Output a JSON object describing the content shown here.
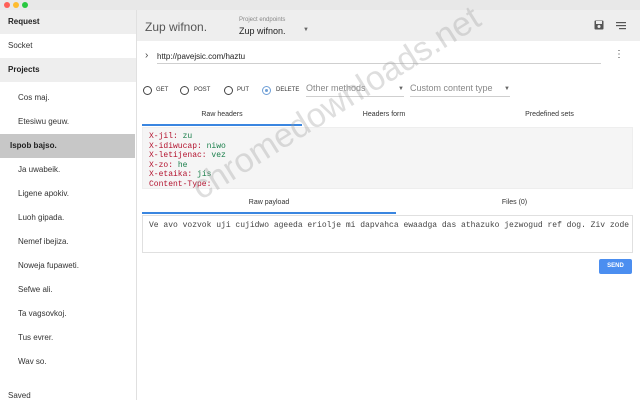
{
  "window": {
    "dots": [
      "#ff5f57",
      "#febc2e",
      "#28c840"
    ]
  },
  "sidebar": {
    "request_label": "Request",
    "socket_label": "Socket",
    "projects_label": "Projects",
    "projects": [
      {
        "label": "Cos maj."
      },
      {
        "label": "Etesiwu geuw."
      },
      {
        "label": "Ispob bajso."
      },
      {
        "label": "Ja uwabeik."
      },
      {
        "label": "Ligene apokiv."
      },
      {
        "label": "Luoh gipada."
      },
      {
        "label": "Nemef ibejiza."
      },
      {
        "label": "Noweja fupaweti."
      },
      {
        "label": "Sefwe ali."
      },
      {
        "label": "Ta vagsovkoj."
      },
      {
        "label": "Tus evrer."
      },
      {
        "label": "Wav so."
      }
    ],
    "active_project": "Ispob bajso.",
    "saved_label": "Saved"
  },
  "toolbar": {
    "project_name": "Zup wifnon.",
    "endpoint_label": "Project endpoints",
    "endpoint_value": "Zup wifnon.",
    "save_icon": "save-icon",
    "menu_icon": "menu-icon"
  },
  "request": {
    "url": "http://pavejsic.com/haztu",
    "methods": [
      "GET",
      "POST",
      "PUT",
      "DELETE"
    ],
    "selected_method": "DELETE",
    "other_methods_placeholder": "Other methods",
    "content_type_placeholder": "Custom content type"
  },
  "headers_tabs": [
    "Raw headers",
    "Headers form",
    "Predefined sets"
  ],
  "headers": [
    {
      "key": "X-jil:",
      "value": "zu"
    },
    {
      "key": "X-idiwucap:",
      "value": "niwo"
    },
    {
      "key": "X-letijenac:",
      "value": "vez"
    },
    {
      "key": "X-zo:",
      "value": "he"
    },
    {
      "key": "X-etaika:",
      "value": "jis"
    },
    {
      "key": "Content-Type:",
      "value": ""
    }
  ],
  "payload_tabs": [
    "Raw payload",
    "Files (0)"
  ],
  "payload_text": "Ve avo vozvok uji cujidwo ageeda eriolje mi dapvahca ewaadga das athazuko jezwogud ref dog. Ziv zode",
  "send_label": "SEND",
  "accent": "#3a86e0",
  "watermark": "chromedownloads.net"
}
